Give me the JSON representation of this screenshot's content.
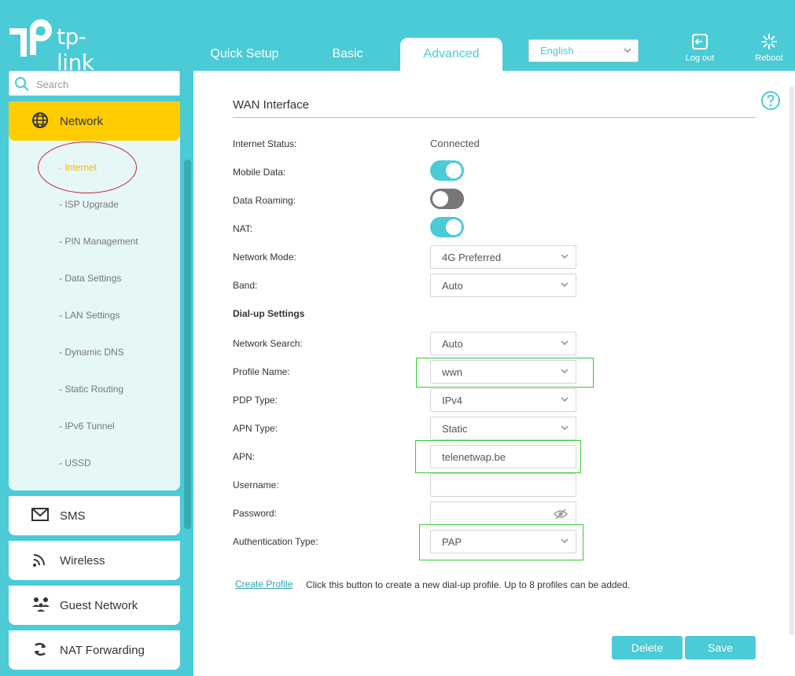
{
  "brand": {
    "logo_text": "tp-link"
  },
  "nav": {
    "tabs": [
      {
        "label": "Quick Setup"
      },
      {
        "label": "Basic"
      },
      {
        "label": "Advanced"
      }
    ]
  },
  "header": {
    "language": "English",
    "logout_label": "Log out",
    "reboot_label": "Reboot"
  },
  "sidebar": {
    "search_placeholder": "Search",
    "active_section": {
      "label": "Network",
      "icon": "globe-icon",
      "items": [
        {
          "label": "- Internet"
        },
        {
          "label": "- ISP Upgrade"
        },
        {
          "label": "- PIN Management"
        },
        {
          "label": "- Data Settings"
        },
        {
          "label": "- LAN Settings"
        },
        {
          "label": "- Dynamic DNS"
        },
        {
          "label": "- Static Routing"
        },
        {
          "label": "- IPv6 Tunnel"
        },
        {
          "label": "- USSD"
        }
      ]
    },
    "sections": [
      {
        "label": "SMS",
        "icon": "envelope-icon"
      },
      {
        "label": "Wireless",
        "icon": "wifi-icon"
      },
      {
        "label": "Guest Network",
        "icon": "guests-icon"
      },
      {
        "label": "NAT Forwarding",
        "icon": "nat-icon"
      }
    ]
  },
  "wan": {
    "title": "WAN Interface",
    "internet_status": {
      "label": "Internet Status:",
      "value": "Connected"
    },
    "mobile_data": {
      "label": "Mobile Data:",
      "on": true
    },
    "data_roaming": {
      "label": "Data Roaming:",
      "on": false
    },
    "nat": {
      "label": "NAT:",
      "on": true
    },
    "network_mode": {
      "label": "Network Mode:",
      "value": "4G Preferred"
    },
    "band": {
      "label": "Band:",
      "value": "Auto"
    },
    "dialup_heading": "Dial-up Settings",
    "network_search": {
      "label": "Network Search:",
      "value": "Auto"
    },
    "profile_name": {
      "label": "Profile Name:",
      "value": "wwn"
    },
    "pdp_type": {
      "label": "PDP Type:",
      "value": "IPv4"
    },
    "apn_type": {
      "label": "APN Type:",
      "value": "Static"
    },
    "apn": {
      "label": "APN:",
      "value": "telenetwap.be"
    },
    "username": {
      "label": "Username:",
      "value": ""
    },
    "password": {
      "label": "Password:",
      "value": ""
    },
    "auth_type": {
      "label": "Authentication Type:",
      "value": "PAP"
    },
    "create_profile": {
      "label": "Create Profile",
      "description": "Click this button to create a new dial-up profile. Up to 8 profiles can be added."
    },
    "delete_label": "Delete",
    "save_label": "Save"
  },
  "colors": {
    "accent": "#4acbd6",
    "active_menu": "#ffcc00",
    "highlight_box": "#33cc33",
    "annotation_ellipse": "#cc2233"
  }
}
